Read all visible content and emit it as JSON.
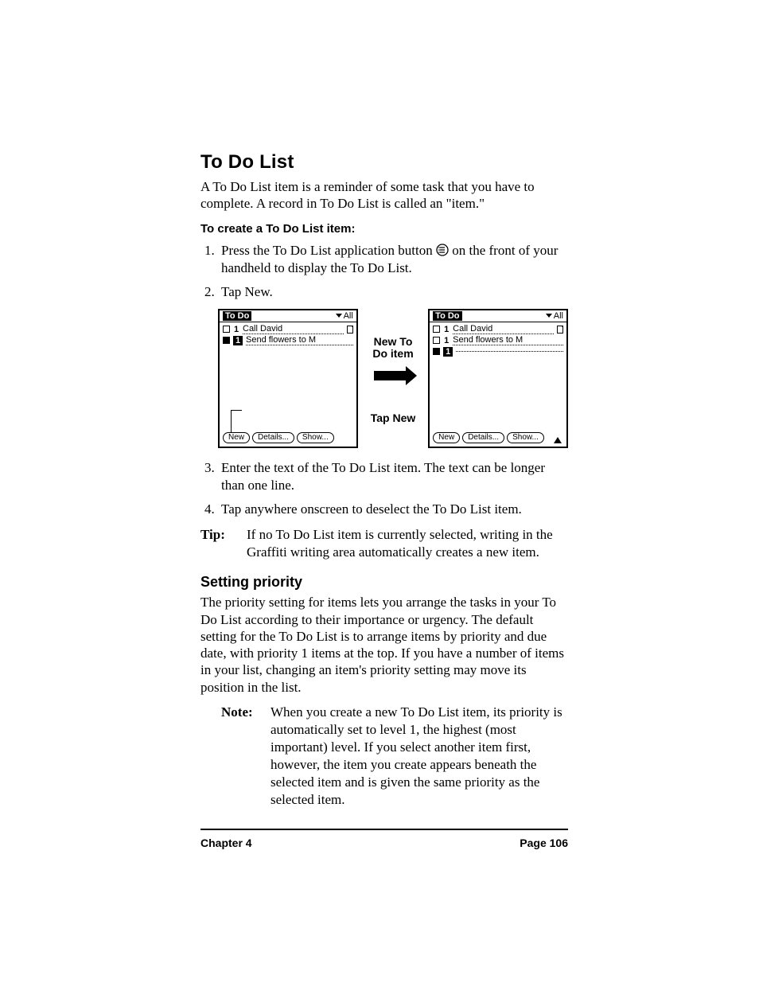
{
  "headings": {
    "main": "To Do List",
    "sub": "Setting priority"
  },
  "intro": "A To Do List item is a reminder of some task that you have to complete. A record in To Do List is called an \"item.\"",
  "procedure_title": "To create a To Do List item:",
  "steps": {
    "s1a": "Press the To Do List application button ",
    "s1b": " on the front of your handheld to display the To Do List.",
    "s2": "Tap New.",
    "s3": "Enter the text of the To Do List item. The text can be longer than one line.",
    "s4": "Tap anywhere onscreen to deselect the To Do List item."
  },
  "tip": {
    "label": "Tip:",
    "text": "If no To Do List item is currently selected, writing in the Graffiti writing area automatically creates a new item."
  },
  "priority_para": "The priority setting for items lets you arrange the tasks in your To Do List according to their importance or urgency. The default setting for the To Do List is to arrange items by priority and due date, with priority 1 items at the top. If you have a number of items in your list, changing an item's priority setting may move its position in the list.",
  "note": {
    "label": "Note:",
    "text": "When you create a new To Do List item, its priority is automatically set to level 1, the highest (most important) level. If you select another item first, however, the item you create appears beneath the selected item and is given the same priority as the selected item."
  },
  "figure": {
    "app_title": "To Do",
    "filter": "All",
    "items": {
      "i1": "Call David",
      "i2": "Send flowers to M"
    },
    "priority": "1",
    "buttons": {
      "new": "New",
      "details": "Details...",
      "show": "Show..."
    },
    "callout_top": "New To Do item",
    "callout_bottom": "Tap New"
  },
  "footer": {
    "left": "Chapter 4",
    "right": "Page 106"
  }
}
